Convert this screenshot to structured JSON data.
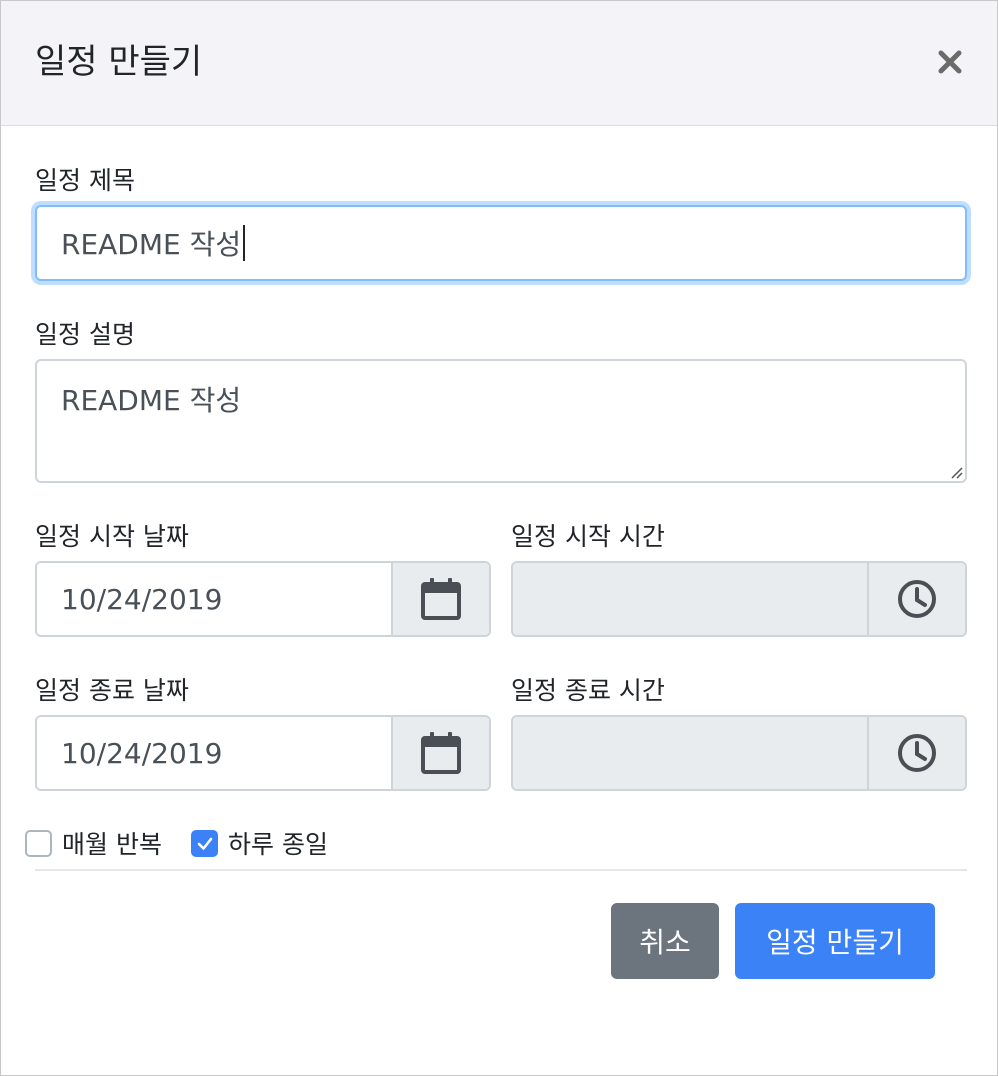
{
  "modal": {
    "title": "일정 만들기",
    "close_icon": "close-icon"
  },
  "form": {
    "title_label": "일정 제목",
    "title_value": "README 작성",
    "description_label": "일정 설명",
    "description_value": "README 작성",
    "start_date_label": "일정 시작 날짜",
    "start_date_value": "10/24/2019",
    "start_time_label": "일정 시작 시간",
    "start_time_value": "",
    "end_date_label": "일정 종료 날짜",
    "end_date_value": "10/24/2019",
    "end_time_label": "일정 종료 시간",
    "end_time_value": "",
    "date_icon": "calendar-icon",
    "time_icon": "clock-icon"
  },
  "options": {
    "monthly_repeat_label": "매월 반복",
    "monthly_repeat_checked": false,
    "all_day_label": "하루 종일",
    "all_day_checked": true
  },
  "footer": {
    "cancel_label": "취소",
    "create_label": "일정 만들기"
  },
  "colors": {
    "primary": "#3b82f6",
    "secondary": "#6c757d",
    "header_bg": "#f4f4f8",
    "addon_bg": "#e9ecef"
  }
}
